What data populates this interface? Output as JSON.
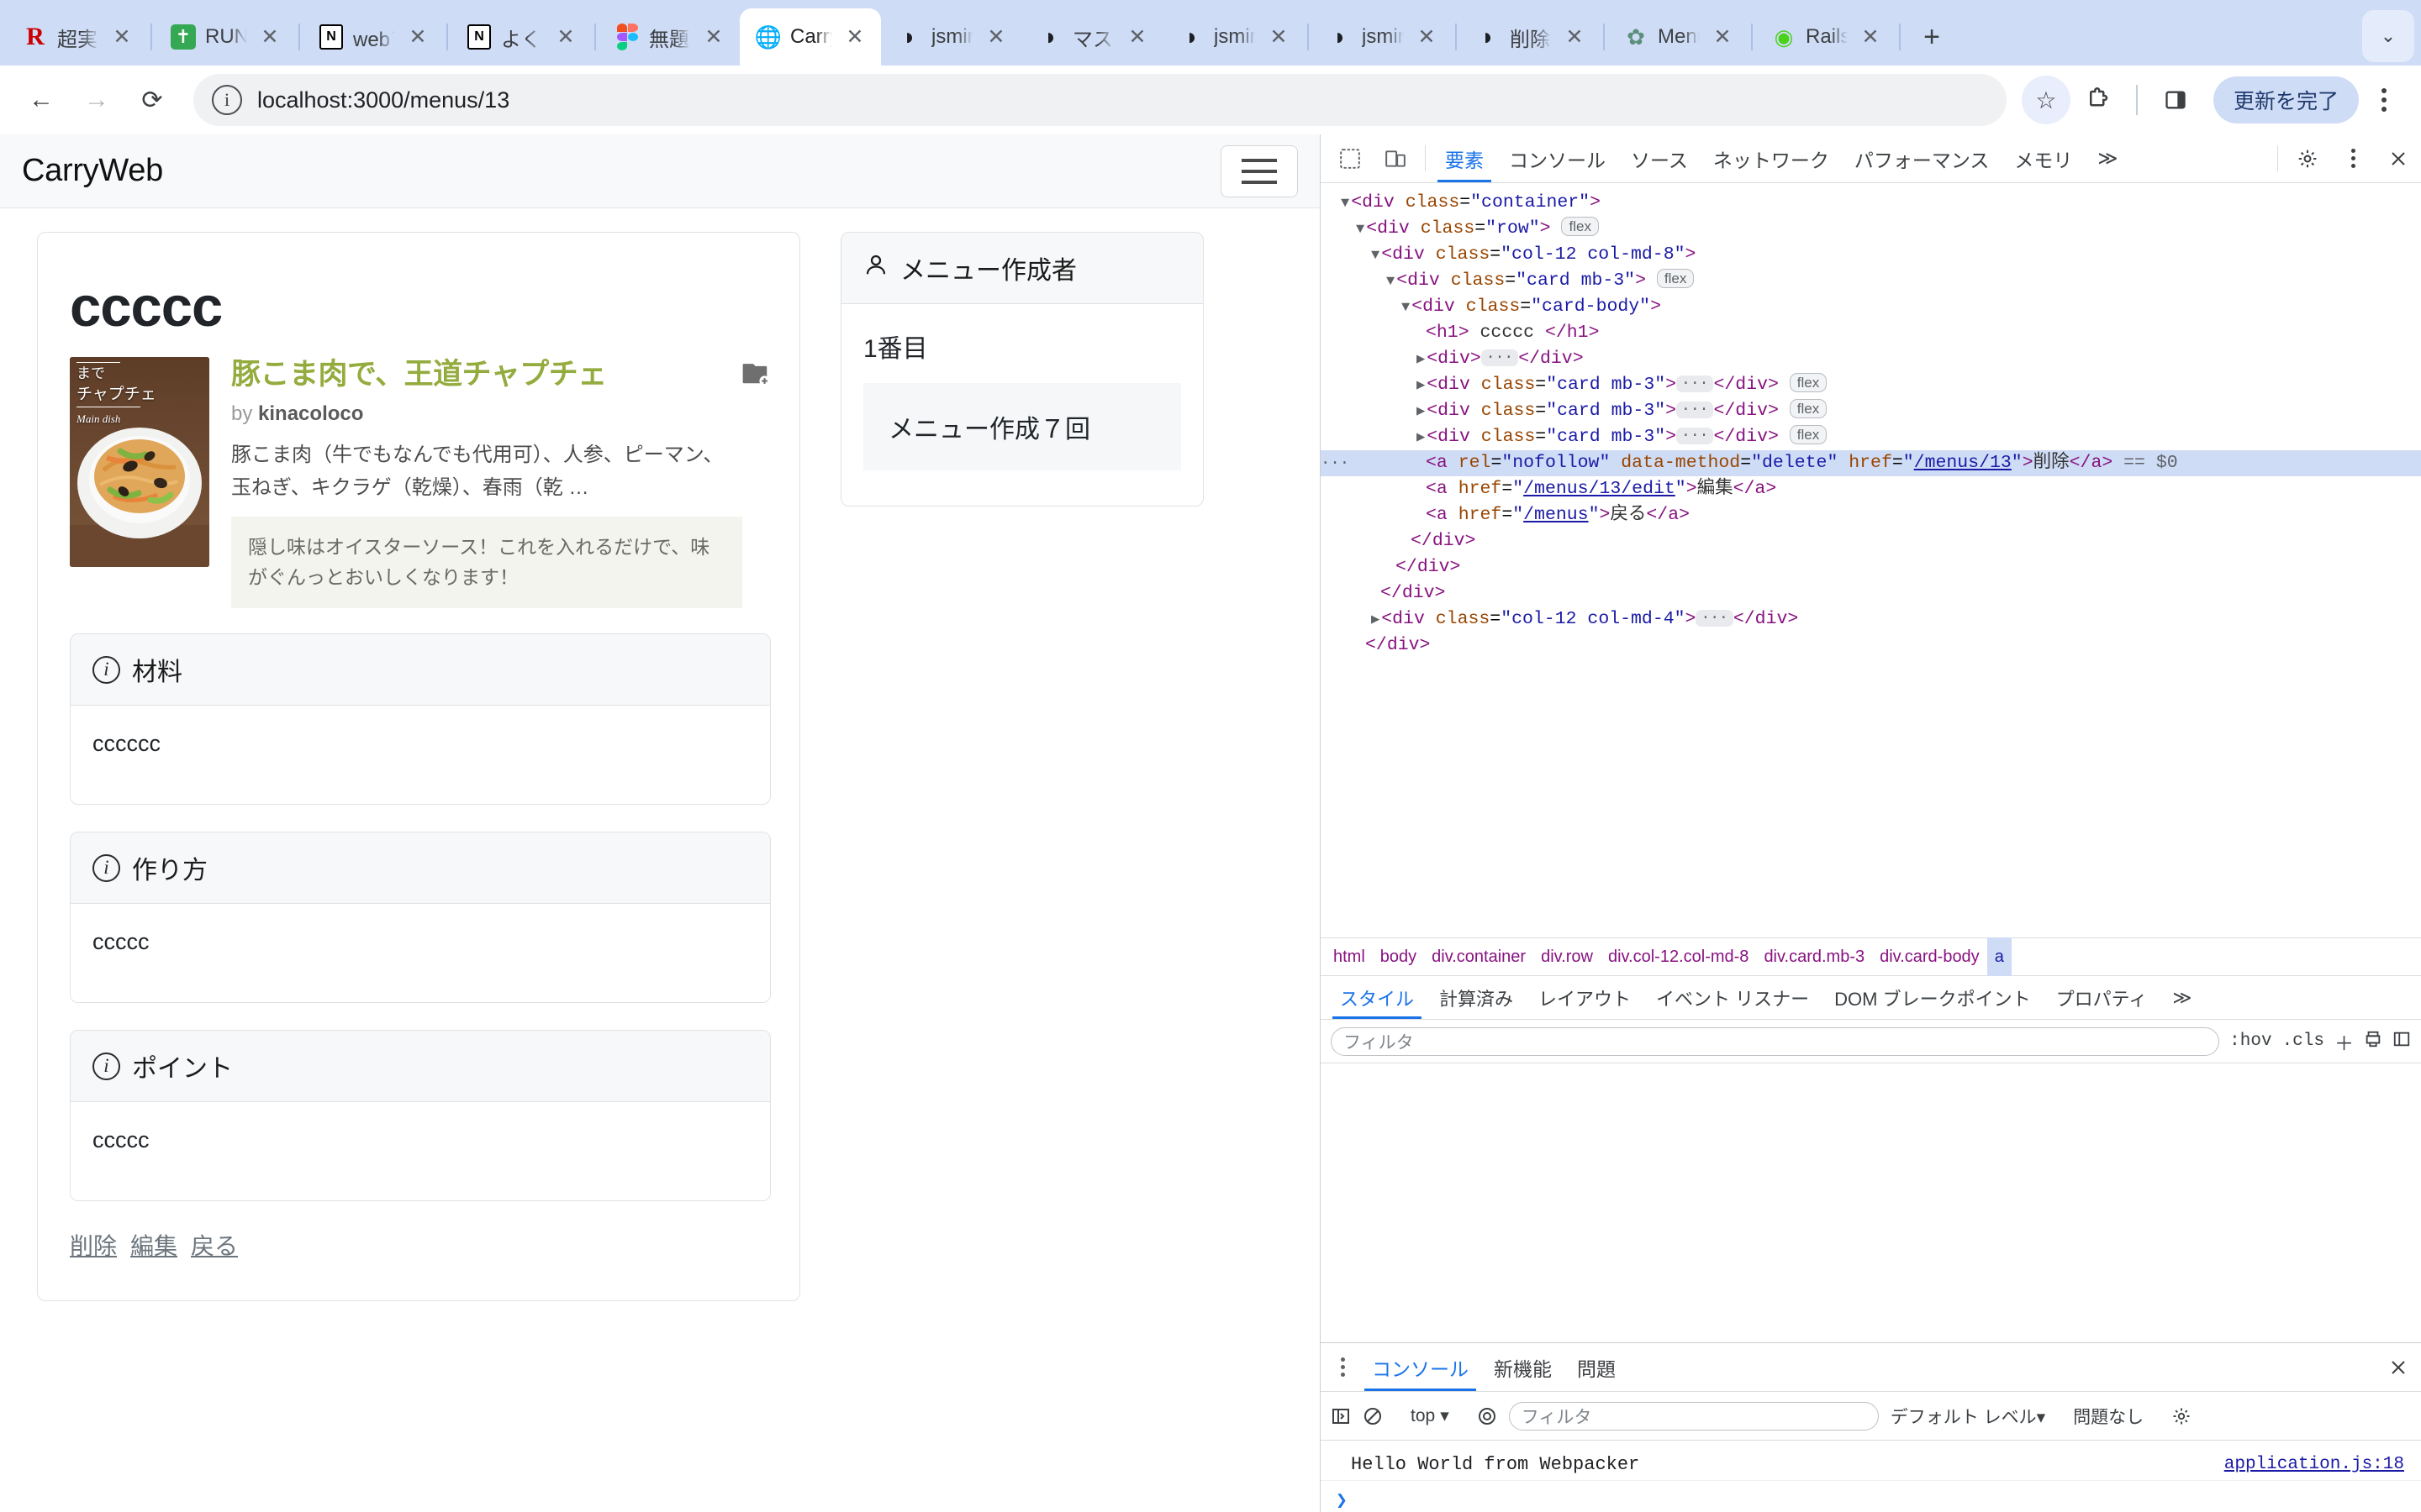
{
  "browser": {
    "tabs": [
      {
        "title": "超実践",
        "favicon": "rails-logo-icon",
        "active": false,
        "sep_after": true
      },
      {
        "title": "RUNT",
        "favicon": "green-cross-icon",
        "active": false,
        "sep_after": true
      },
      {
        "title": "webア",
        "favicon": "notion-icon",
        "active": false,
        "sep_after": true
      },
      {
        "title": "よく使",
        "favicon": "notion-icon",
        "active": false,
        "sep_after": true
      },
      {
        "title": "無題 -",
        "favicon": "figma-icon",
        "active": false,
        "sep_after": false
      },
      {
        "title": "Carry",
        "favicon": "globe-icon",
        "active": true,
        "sep_after": false
      },
      {
        "title": "jsmin",
        "favicon": "github-icon",
        "active": false,
        "sep_after": false
      },
      {
        "title": "マスタ",
        "favicon": "github-icon",
        "active": false,
        "sep_after": false
      },
      {
        "title": "jsmin",
        "favicon": "github-icon",
        "active": false,
        "sep_after": true
      },
      {
        "title": "jsmin",
        "favicon": "github-icon",
        "active": false,
        "sep_after": true
      },
      {
        "title": "削除機",
        "favicon": "github-icon",
        "active": false,
        "sep_after": true
      },
      {
        "title": "Menu",
        "favicon": "openai-icon",
        "active": false,
        "sep_after": true
      },
      {
        "title": "Rails",
        "favicon": "rails-green-icon",
        "active": false,
        "sep_after": true
      }
    ],
    "new_tab_label": "+",
    "tab_list_chevron": "⌄",
    "back_label": "←",
    "forward_label": "→",
    "reload_label": "⟳",
    "omnibox": {
      "info_icon_label": "i",
      "url": "localhost:3000/menus/13"
    },
    "star_label": "☆",
    "extensions_label": "extensions-icon",
    "sidepanel_label": "side-panel-icon",
    "update_button": "更新を完了"
  },
  "page": {
    "brand": "CarryWeb",
    "toggler": "navbar-toggler",
    "h1": "ccccc",
    "recipe": {
      "title": "豚こま肉で、王道チャプチェ",
      "by_prefix": "by",
      "author": "kinacoloco",
      "description": "豚こま肉（牛でもなんでも代用可）、人参、ピーマン、玉ねぎ、キクラゲ（乾燥）、春雨（乾 …",
      "note": "隠し味はオイスターソース！これを入れるだけで、味がぐんっとおいしくなります！",
      "thumb_caption_1": "まで",
      "thumb_caption_2": "チャプチェ",
      "thumb_caption_3": "Main dish"
    },
    "cards": [
      {
        "heading": "材料",
        "body": "cccccc"
      },
      {
        "heading": "作り方",
        "body": "ccccc"
      },
      {
        "heading": "ポイント",
        "body": "ccccc"
      }
    ],
    "actions": [
      {
        "label": "削除"
      },
      {
        "label": "編集"
      },
      {
        "label": "戻る"
      }
    ],
    "sidebar": {
      "heading": "メニュー作成者",
      "rank": "1番目",
      "count": "メニュー作成７回"
    }
  },
  "devtools": {
    "inspect_icon": "inspect-element-icon",
    "device_icon": "device-toolbar-icon",
    "tabs": [
      {
        "label": "要素",
        "selected": true
      },
      {
        "label": "コンソール",
        "selected": false
      },
      {
        "label": "ソース",
        "selected": false
      },
      {
        "label": "ネットワーク",
        "selected": false
      },
      {
        "label": "パフォーマンス",
        "selected": false
      },
      {
        "label": "メモリ",
        "selected": false
      },
      {
        "label": "≫",
        "selected": false
      }
    ],
    "settings_icon": "gear-icon",
    "more_icon": "kebab-icon",
    "close_icon": "close-icon",
    "dom_lines": [
      {
        "indent": 0,
        "marker": "▼",
        "html": "<span class=\"tp\">&lt;</span><span class=\"tn\">div</span> <span class=\"ta\">class</span>=<span class=\"tv\">\"container\"</span><span class=\"tp\">&gt;</span>"
      },
      {
        "indent": 1,
        "marker": "▼",
        "html": "<span class=\"tp\">&lt;</span><span class=\"tn\">div</span> <span class=\"ta\">class</span>=<span class=\"tv\">\"row\"</span><span class=\"tp\">&gt;</span> <span class=\"chip\">flex</span>"
      },
      {
        "indent": 2,
        "marker": "▼",
        "html": "<span class=\"tp\">&lt;</span><span class=\"tn\">div</span> <span class=\"ta\">class</span>=<span class=\"tv\">\"col-12 col-md-8\"</span><span class=\"tp\">&gt;</span>"
      },
      {
        "indent": 3,
        "marker": "▼",
        "html": "<span class=\"tp\">&lt;</span><span class=\"tn\">div</span> <span class=\"ta\">class</span>=<span class=\"tv\">\"card mb-3\"</span><span class=\"tp\">&gt;</span> <span class=\"chip\">flex</span>"
      },
      {
        "indent": 4,
        "marker": "▼",
        "html": "<span class=\"tp\">&lt;</span><span class=\"tn\">div</span> <span class=\"ta\">class</span>=<span class=\"tv\">\"card-body\"</span><span class=\"tp\">&gt;</span>"
      },
      {
        "indent": 5,
        "marker": "",
        "html": "<span class=\"tp\">&lt;</span><span class=\"tn\">h1</span><span class=\"tp\">&gt;</span> <span class=\"tt\">ccccc</span> <span class=\"tp\">&lt;/</span><span class=\"tn\">h1</span><span class=\"tp\">&gt;</span>"
      },
      {
        "indent": 5,
        "marker": "▶",
        "html": "<span class=\"tp\">&lt;</span><span class=\"tn\">div</span><span class=\"tp\">&gt;</span><span class=\"dots\">···</span><span class=\"tp\">&lt;/</span><span class=\"tn\">div</span><span class=\"tp\">&gt;</span>"
      },
      {
        "indent": 5,
        "marker": "▶",
        "html": "<span class=\"tp\">&lt;</span><span class=\"tn\">div</span> <span class=\"ta\">class</span>=<span class=\"tv\">\"card mb-3\"</span><span class=\"tp\">&gt;</span><span class=\"dots\">···</span><span class=\"tp\">&lt;/</span><span class=\"tn\">div</span><span class=\"tp\">&gt;</span> <span class=\"chip\">flex</span>"
      },
      {
        "indent": 5,
        "marker": "▶",
        "html": "<span class=\"tp\">&lt;</span><span class=\"tn\">div</span> <span class=\"ta\">class</span>=<span class=\"tv\">\"card mb-3\"</span><span class=\"tp\">&gt;</span><span class=\"dots\">···</span><span class=\"tp\">&lt;/</span><span class=\"tn\">div</span><span class=\"tp\">&gt;</span> <span class=\"chip\">flex</span>"
      },
      {
        "indent": 5,
        "marker": "▶",
        "html": "<span class=\"tp\">&lt;</span><span class=\"tn\">div</span> <span class=\"ta\">class</span>=<span class=\"tv\">\"card mb-3\"</span><span class=\"tp\">&gt;</span><span class=\"dots\">···</span><span class=\"tp\">&lt;/</span><span class=\"tn\">div</span><span class=\"tp\">&gt;</span> <span class=\"chip\">flex</span>"
      },
      {
        "indent": 5,
        "marker": "",
        "selected": true,
        "html": "<span class=\"tp\">&lt;</span><span class=\"tn\">a</span> <span class=\"ta\">rel</span>=<span class=\"tv\">\"nofollow\"</span> <span class=\"ta\">data-method</span>=<span class=\"tv\">\"delete\"</span> <span class=\"ta\">href</span>=<span class=\"tv\">\"</span><span class=\"tlink\">/menus/13</span><span class=\"tv\">\"</span><span class=\"tp\">&gt;</span><span class=\"tt\">削除</span><span class=\"tp\">&lt;/</span><span class=\"tn\">a</span><span class=\"tp\">&gt;</span> <span class=\"tgray\">== $0</span>"
      },
      {
        "indent": 5,
        "marker": "",
        "html": "<span class=\"tp\">&lt;</span><span class=\"tn\">a</span> <span class=\"ta\">href</span>=<span class=\"tv\">\"</span><span class=\"tlink\">/menus/13/edit</span><span class=\"tv\">\"</span><span class=\"tp\">&gt;</span><span class=\"tt\">編集</span><span class=\"tp\">&lt;/</span><span class=\"tn\">a</span><span class=\"tp\">&gt;</span>"
      },
      {
        "indent": 5,
        "marker": "",
        "html": "<span class=\"tp\">&lt;</span><span class=\"tn\">a</span> <span class=\"ta\">href</span>=<span class=\"tv\">\"</span><span class=\"tlink\">/menus</span><span class=\"tv\">\"</span><span class=\"tp\">&gt;</span><span class=\"tt\">戻る</span><span class=\"tp\">&lt;/</span><span class=\"tn\">a</span><span class=\"tp\">&gt;</span>"
      },
      {
        "indent": 4,
        "marker": "",
        "html": "<span class=\"tp\">&lt;/</span><span class=\"tn\">div</span><span class=\"tp\">&gt;</span>"
      },
      {
        "indent": 3,
        "marker": "",
        "html": "<span class=\"tp\">&lt;/</span><span class=\"tn\">div</span><span class=\"tp\">&gt;</span>"
      },
      {
        "indent": 2,
        "marker": "",
        "html": "<span class=\"tp\">&lt;/</span><span class=\"tn\">div</span><span class=\"tp\">&gt;</span>"
      },
      {
        "indent": 2,
        "marker": "▶",
        "html": "<span class=\"tp\">&lt;</span><span class=\"tn\">div</span> <span class=\"ta\">class</span>=<span class=\"tv\">\"col-12 col-md-4\"</span><span class=\"tp\">&gt;</span><span class=\"dots\">···</span><span class=\"tp\">&lt;/</span><span class=\"tn\">div</span><span class=\"tp\">&gt;</span>"
      },
      {
        "indent": 1,
        "marker": "",
        "html": "<span class=\"tp\">&lt;/</span><span class=\"tn\">div</span><span class=\"tp\">&gt;</span>"
      }
    ],
    "breadcrumbs": [
      {
        "label": "html",
        "selected": false
      },
      {
        "label": "body",
        "selected": false
      },
      {
        "label": "div.container",
        "selected": false
      },
      {
        "label": "div.row",
        "selected": false
      },
      {
        "label": "div.col-12.col-md-8",
        "selected": false
      },
      {
        "label": "div.card.mb-3",
        "selected": false
      },
      {
        "label": "div.card-body",
        "selected": false
      },
      {
        "label": "a",
        "selected": true
      }
    ],
    "style_tabs": [
      {
        "label": "スタイル",
        "selected": true
      },
      {
        "label": "計算済み",
        "selected": false
      },
      {
        "label": "レイアウト",
        "selected": false
      },
      {
        "label": "イベント リスナー",
        "selected": false
      },
      {
        "label": "DOM ブレークポイント",
        "selected": false
      },
      {
        "label": "プロパティ",
        "selected": false
      },
      {
        "label": "≫",
        "selected": false
      }
    ],
    "style_filter_placeholder": "フィルタ",
    "style_actions": [
      ":hov",
      ".cls"
    ],
    "style_icons": [
      "plus-icon",
      "print-style-icon",
      "sidebar-toggle-icon"
    ],
    "drawer": {
      "tabs": [
        {
          "label": "コンソール",
          "selected": true
        },
        {
          "label": "新機能",
          "selected": false
        },
        {
          "label": "問題",
          "selected": false
        }
      ],
      "close_icon": "close-icon",
      "sidebar_icon": "console-sidebar-icon",
      "clear_icon": "clear-console-icon",
      "context": "top",
      "eye_icon": "live-expression-icon",
      "filter_placeholder": "フィルタ",
      "level": "デフォルト レベル",
      "issues": "問題なし",
      "settings_icon": "gear-icon",
      "messages": [
        {
          "text": "Hello World from Webpacker",
          "source": "application.js:18"
        }
      ],
      "prompt": "❯"
    }
  }
}
